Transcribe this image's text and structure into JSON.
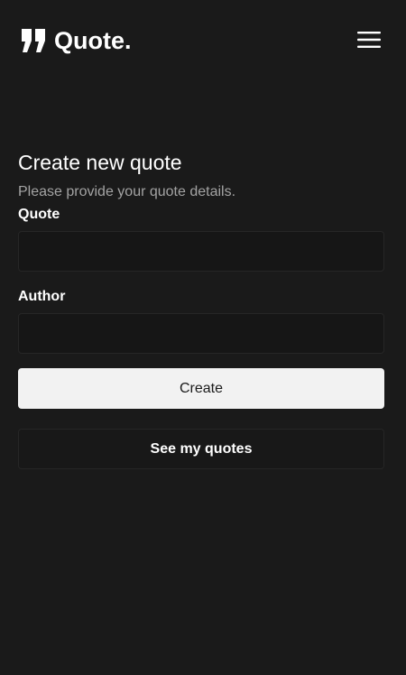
{
  "header": {
    "logo_icon": "quote-mark-icon",
    "logo_text": "Quote.",
    "menu_icon": "hamburger-menu-icon"
  },
  "form": {
    "title": "Create new quote",
    "subtitle": "Please provide your quote details.",
    "quote_label": "Quote",
    "quote_value": "",
    "quote_placeholder": "",
    "author_label": "Author",
    "author_value": "",
    "author_placeholder": "",
    "create_label": "Create",
    "see_quotes_label": "See my quotes"
  },
  "colors": {
    "background": "#1a1a1a",
    "input_background": "#161616",
    "input_border": "#262626",
    "primary_button": "#f2f2f2",
    "primary_button_text": "#1a1a1a",
    "subtitle_text": "#a3a3a3",
    "text": "#ffffff"
  }
}
